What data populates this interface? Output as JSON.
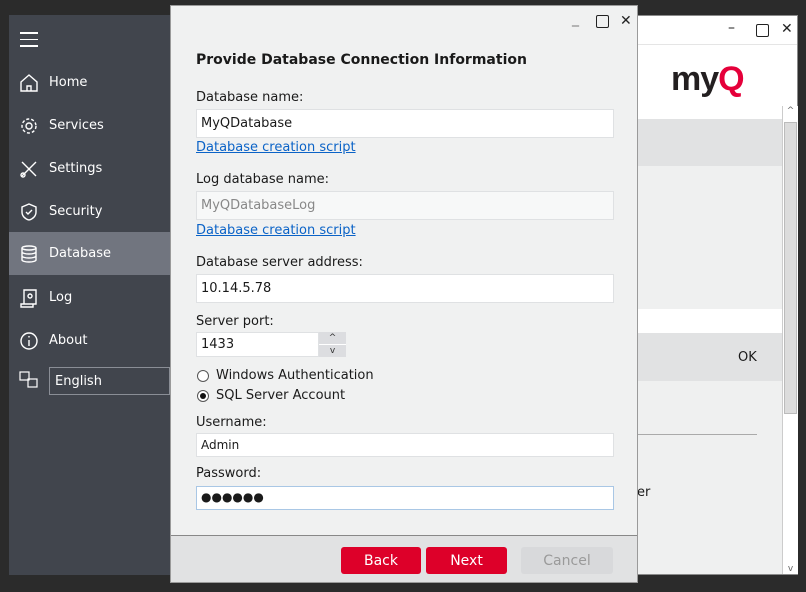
{
  "sidebar": {
    "items": [
      {
        "label": "Home",
        "icon": "home-icon"
      },
      {
        "label": "Services",
        "icon": "gear-icon"
      },
      {
        "label": "Settings",
        "icon": "tools-icon"
      },
      {
        "label": "Security",
        "icon": "shield-icon"
      },
      {
        "label": "Database",
        "icon": "database-icon",
        "selected": true
      },
      {
        "label": "Log",
        "icon": "log-scroll-icon"
      },
      {
        "label": "About",
        "icon": "info-icon"
      }
    ],
    "language": "English"
  },
  "background_window": {
    "logo": "myQ",
    "ok_label": "OK",
    "partial_text": "er"
  },
  "dialog": {
    "title": "Provide Database Connection Information",
    "db_name_label": "Database name:",
    "db_name_value": "MyQDatabase",
    "db_script_link": "Database creation script",
    "log_db_label": "Log database name:",
    "log_db_value": "MyQDatabaseLog",
    "log_script_link": "Database creation script",
    "server_label": "Database server address:",
    "server_value": "10.14.5.78",
    "port_label": "Server port:",
    "port_value": "1433",
    "auth_windows": "Windows Authentication",
    "auth_sql": "SQL Server Account",
    "auth_selected": "SQL Server Account",
    "username_label": "Username:",
    "username_value": "Admin",
    "password_label": "Password:",
    "password_value": "●●●●●●",
    "back": "Back",
    "next": "Next",
    "cancel": "Cancel"
  },
  "colors": {
    "accent": "#dd0029",
    "sidebar": "#41454d",
    "sidebar_selected": "#71757f",
    "link": "#0b63c7"
  }
}
